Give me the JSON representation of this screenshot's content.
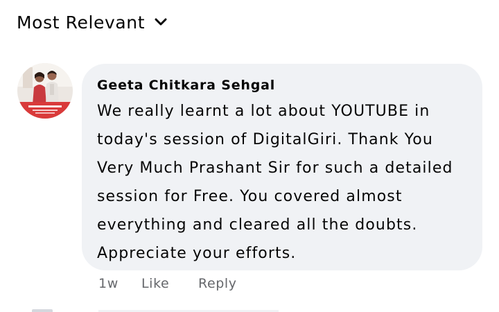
{
  "sort": {
    "label": "Most Relevant",
    "icon": "chevron-down-icon"
  },
  "comment": {
    "author": "Geeta Chitkara Sehgal",
    "text": "We really learnt a lot about YOUTUBE in today's session of DigitalGiri. Thank You Very Much Prashant Sir for such a detailed session for Free. You covered almost everything and cleared all the doubts. Appreciate your efforts.",
    "time": "1w",
    "like_label": "Like",
    "reply_label": "Reply",
    "avatar_icon": "profile-photo-avatar"
  },
  "colors": {
    "bubble_bg": "#f0f2f5",
    "secondary_text": "#65676b",
    "avatar_banner": "#d93a3a"
  }
}
